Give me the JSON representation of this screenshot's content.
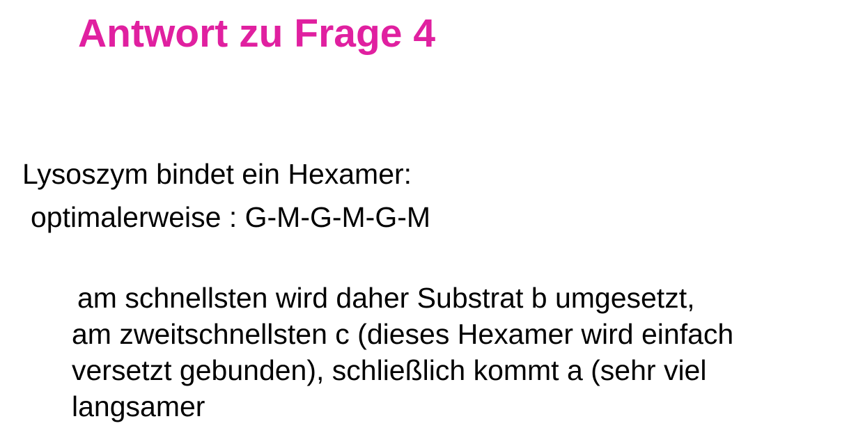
{
  "title": "Antwort zu Frage 4",
  "colors": {
    "title": "#e020a0",
    "text": "#000000",
    "background": "#ffffff"
  },
  "body": {
    "line1": "Lysoszym bindet ein Hexamer:",
    "line2": "optimalerweise : G-M-G-M-G-M",
    "paragraph": [
      "am schnellsten wird daher Substrat b umgesetzt,",
      "am zweitschnellsten c (dieses Hexamer wird einfach",
      "versetzt gebunden), schließlich kommt a (sehr viel",
      "langsamer"
    ]
  }
}
